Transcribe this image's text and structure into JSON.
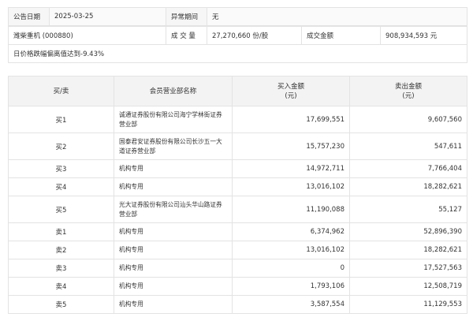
{
  "info": {
    "date_label": "公告日期",
    "date_value": "2025-03-25",
    "period_label": "异常期间",
    "period_value": "无",
    "stock_name": "潍柴重机 (000880)",
    "volume_label": "成 交 量",
    "volume_value": "27,270,660 份/股",
    "amount_label": "成交金额",
    "amount_value": "908,934,593 元",
    "reason": "日价格跌幅偏离值达到-9.43%"
  },
  "trade_table": {
    "headers": [
      "买/卖",
      "会员营业部名称",
      "买入金额\n(元)",
      "卖出金额\n(元)"
    ],
    "rows": [
      {
        "side": "买1",
        "name": "诚通证券股份有限公司海宁学林街证券营业部",
        "buy": "17,699,551",
        "sell": "9,607,560"
      },
      {
        "side": "买2",
        "name": "国泰君安证券股份有限公司长沙五一大道证券营业部",
        "buy": "15,757,230",
        "sell": "547,611"
      },
      {
        "side": "买3",
        "name": "机构专用",
        "buy": "14,972,711",
        "sell": "7,766,404"
      },
      {
        "side": "买4",
        "name": "机构专用",
        "buy": "13,016,102",
        "sell": "18,282,621"
      },
      {
        "side": "买5",
        "name": "光大证券股份有限公司汕头华山路证券营业部",
        "buy": "11,190,088",
        "sell": "55,127"
      },
      {
        "side": "卖1",
        "name": "机构专用",
        "buy": "6,374,962",
        "sell": "52,896,390"
      },
      {
        "side": "卖2",
        "name": "机构专用",
        "buy": "13,016,102",
        "sell": "18,282,621"
      },
      {
        "side": "卖3",
        "name": "机构专用",
        "buy": "0",
        "sell": "17,527,563"
      },
      {
        "side": "卖4",
        "name": "机构专用",
        "buy": "1,793,106",
        "sell": "12,508,719"
      },
      {
        "side": "卖5",
        "name": "机构专用",
        "buy": "3,587,554",
        "sell": "11,129,553"
      }
    ]
  }
}
